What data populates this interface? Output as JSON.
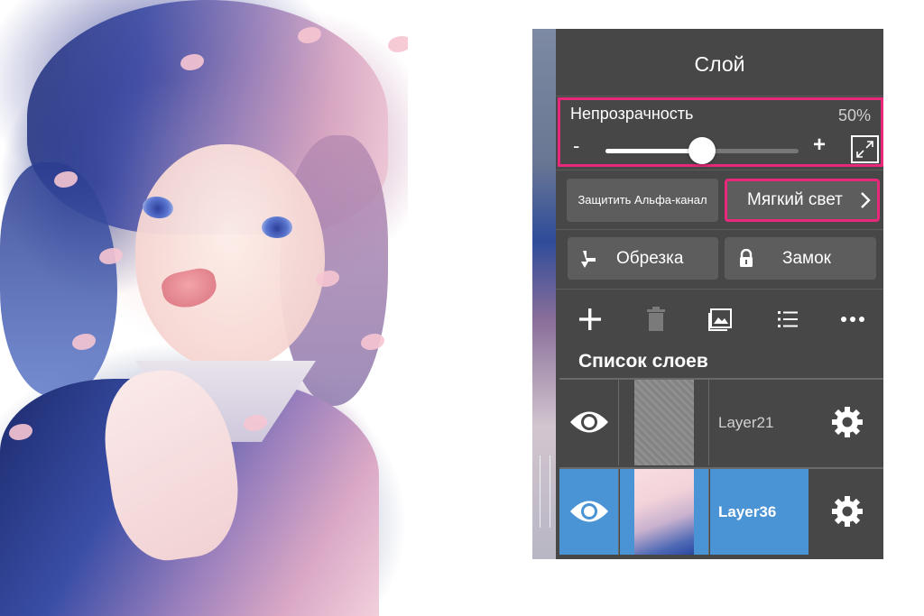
{
  "panel": {
    "title": "Слой",
    "opacity": {
      "label": "Непрозрачность",
      "value_text": "50%",
      "value": 0.5,
      "minus_label": "-",
      "plus_label": "+",
      "expand_icon": "expand-icon"
    },
    "protect_alpha_label": "Защитить Альфа-канал",
    "blend_mode_label": "Мягкий свет",
    "clipping_label": "Обрезка",
    "lock_label": "Замок",
    "toolbar_icons": [
      "add-layer-icon",
      "delete-layer-icon",
      "import-image-icon",
      "layer-menu-icon",
      "more-icon"
    ],
    "layer_list_title": "Список слоев",
    "layers": [
      {
        "name": "Layer21",
        "visible": true,
        "selected": false
      },
      {
        "name": "Layer36",
        "visible": true,
        "selected": true
      }
    ]
  },
  "colors": {
    "panel_bg": "#474747",
    "button_bg": "#5d5d5d",
    "highlight": "#e8287a",
    "selected_layer": "#4a93d4"
  }
}
